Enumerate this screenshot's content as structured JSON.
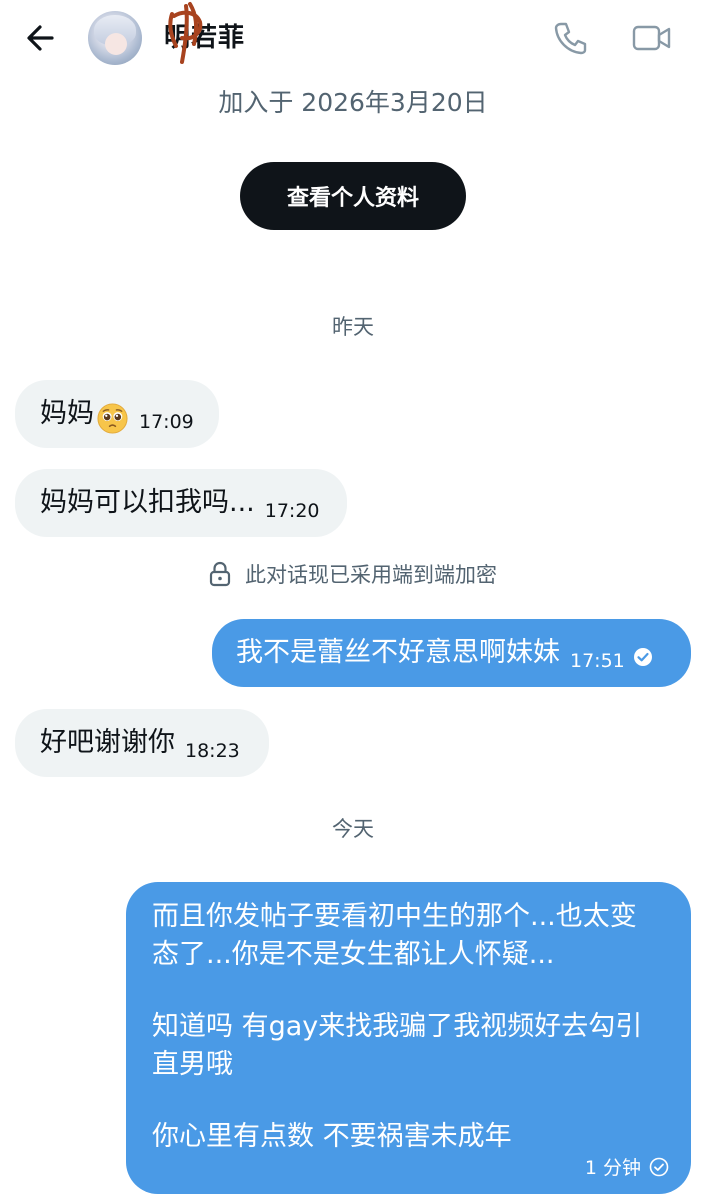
{
  "header": {
    "contact_name": "明若菲",
    "icons": {
      "back": "arrow-left-icon",
      "call": "phone-icon",
      "video": "video-camera-icon"
    }
  },
  "profile": {
    "joined": "加入于 2026年3月20日",
    "view_profile_label": "查看个人资料"
  },
  "dates": {
    "yesterday": "昨天",
    "today": "今天"
  },
  "encryption_notice": "此对话现已采用端到端加密",
  "messages": [
    {
      "direction": "incoming",
      "text": "妈妈",
      "emoji": "pleading-face-emoji",
      "time": "17:09"
    },
    {
      "direction": "incoming",
      "text": "妈妈可以扣我吗...",
      "time": "17:20"
    },
    {
      "direction": "outgoing",
      "text": "我不是蕾丝不好意思啊妹妹",
      "time": "17:51",
      "status": "read"
    },
    {
      "direction": "incoming",
      "text": "好吧谢谢你",
      "time": "18:23"
    },
    {
      "direction": "outgoing",
      "lines": [
        "而且你发帖子要看初中生的那个...也太变",
        "态了...你是不是女生都让人怀疑...",
        "",
        "知道吗 有gay来找我骗了我视频好去勾引",
        "直男哦",
        "",
        "你心里有点数 不要祸害未成年"
      ],
      "time": "1 分钟",
      "status": "sent"
    }
  ],
  "colors": {
    "outgoing_bubble": "#4a9ae6",
    "incoming_bubble": "#eff3f4",
    "primary_button": "#0f1419",
    "secondary_text": "#536471"
  }
}
